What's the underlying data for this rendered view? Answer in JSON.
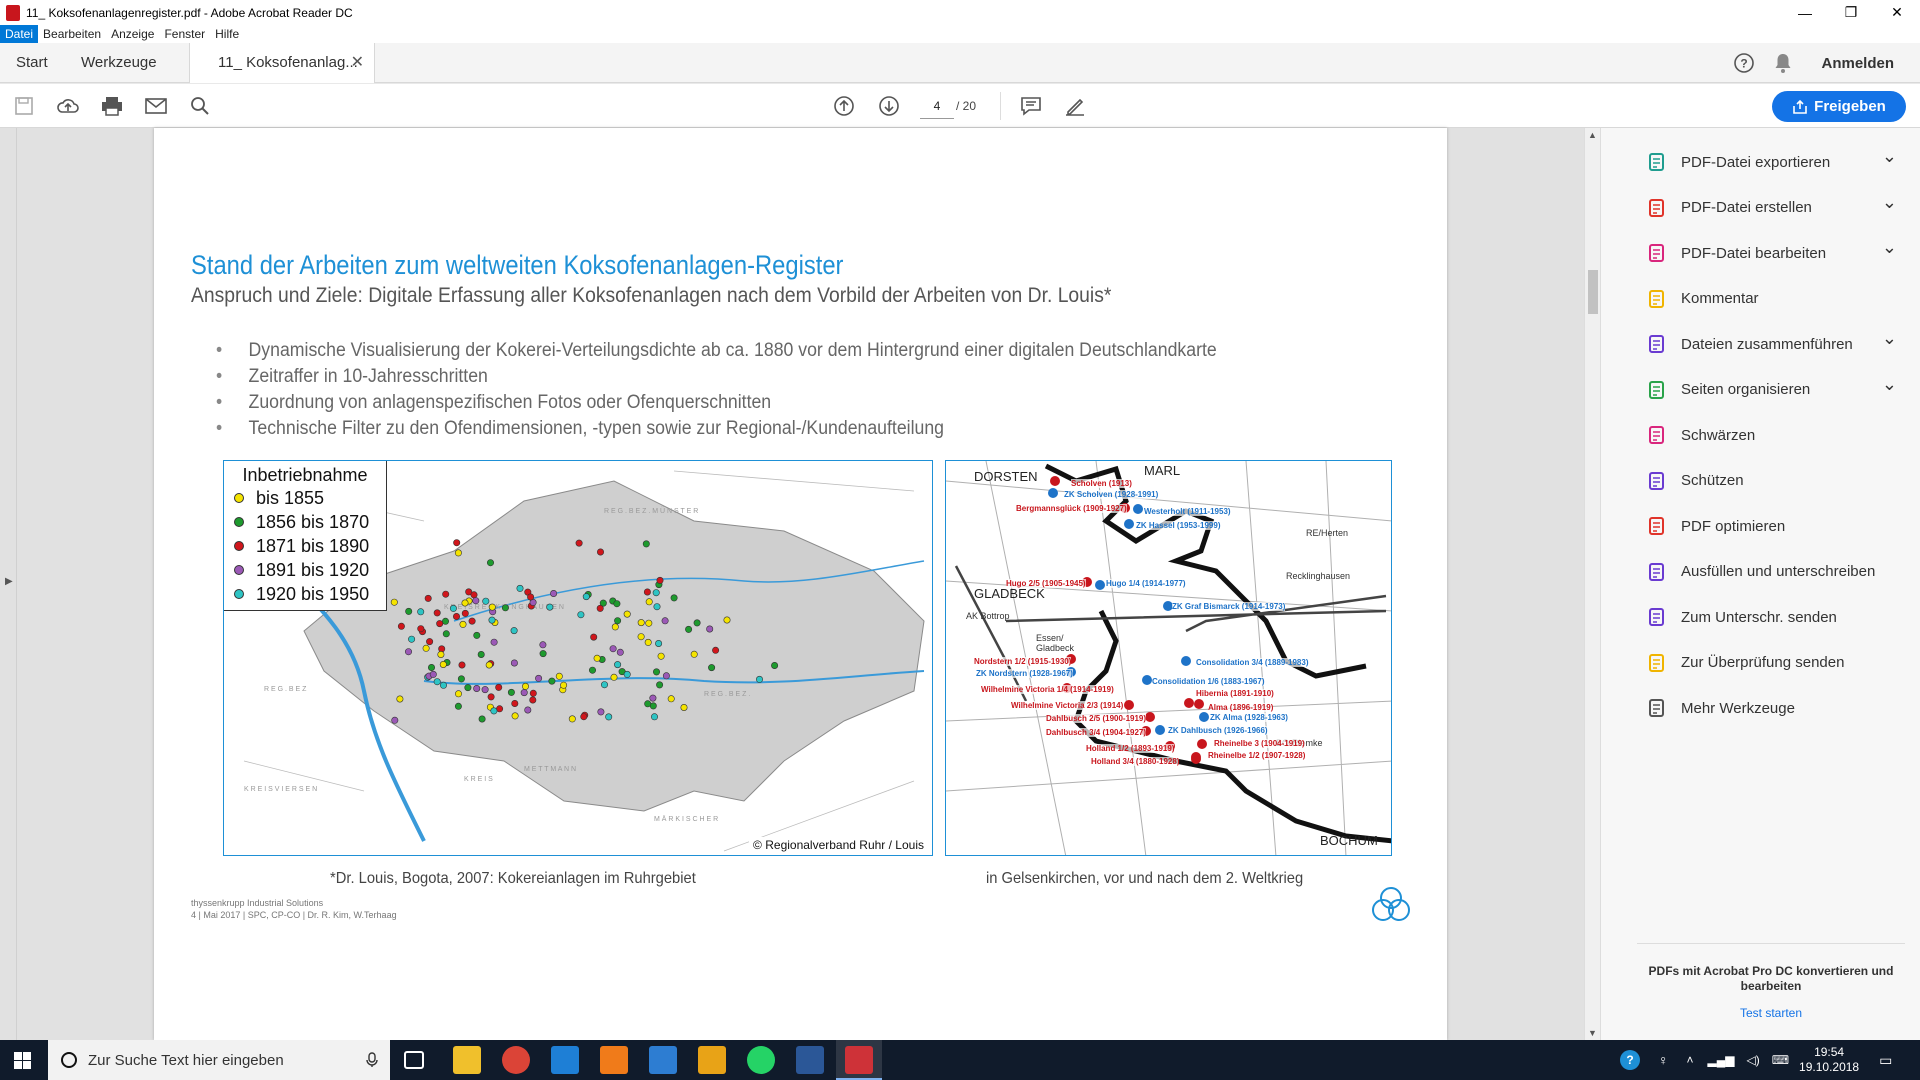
{
  "window": {
    "title": "11_ Koksofenanlagenregister.pdf - Adobe Acrobat Reader DC",
    "minimize": "—",
    "maximize": "❐",
    "close": "✕"
  },
  "menu": [
    "Datei",
    "Bearbeiten",
    "Anzeige",
    "Fenster",
    "Hilfe"
  ],
  "tabs": {
    "start": "Start",
    "tools": "Werkzeuge",
    "doc": "11_ Koksofenanlag...",
    "signin": "Anmelden"
  },
  "toolbar": {
    "page_current": "4",
    "page_total": "/ 20",
    "share_label": "Freigeben"
  },
  "slide": {
    "title": "Stand der Arbeiten zum weltweiten Koksofenanlagen-Register",
    "subtitle": "Anspruch und Ziele: Digitale Erfassung aller Koksofenanlagen nach dem Vorbild der Arbeiten von Dr. Louis*",
    "bullets": [
      "Dynamische Visualisierung der Kokerei-Verteilungsdichte ab ca. 1880 vor dem Hintergrund einer digitalen Deutschlandkarte",
      "Zeitraffer in 10-Jahresschritten",
      "Zuordnung von anlagenspezifischen Fotos oder Ofenquerschnitten",
      "Technische Filter zu den Ofendimensionen, -typen sowie zur Regional-/Kundenaufteilung"
    ],
    "legend": {
      "title": "Inbetriebnahme",
      "items": [
        {
          "label": "bis 1855",
          "color": "#f5e400"
        },
        {
          "label": "1856 bis 1870",
          "color": "#1e9a2e"
        },
        {
          "label": "1871 bis 1890",
          "color": "#d0161c"
        },
        {
          "label": "1891 bis 1920",
          "color": "#9b59b6"
        },
        {
          "label": "1920 bis 1950",
          "color": "#2ec4c4"
        }
      ]
    },
    "map1_copyright": "© Regionalverband Ruhr / Louis",
    "map2_labels": {
      "red": [
        "Scholven (1913)",
        "Bergmannsglück (1909-1927)",
        "Hugo 2/5 (1905-1945)",
        "Nordstern 1/2 (1915-1930)",
        "Wilhelmine Victoria 1/4 (1914-1919)",
        "Wilhelmine Victoria 2/3 (1914)",
        "Hibernia (1891-1910)",
        "Alma (1896-1919)",
        "Dahlbusch 2/5 (1900-1919)",
        "Dahlbusch 3/4 (1904-1927)",
        "Holland 1/2 (1893-1919)",
        "Holland 3/4 (1880-1928)",
        "Rheinelbe 3 (1904-1919)",
        "Rheinelbe 1/2 (1907-1928)"
      ],
      "blue": [
        "ZK Scholven (1928-1991)",
        "Westerholt (1911-1953)",
        "ZK Hassel (1953-1999)",
        "Hugo 1/4 (1914-1977)",
        "ZK Graf Bismarck (1914-1973)",
        "ZK Nordstern (1928-1967)",
        "Consolidation 3/4 (1889-1983)",
        "Consolidation 1/6 (1883-1967)",
        "ZK Alma (1928-1963)",
        "ZK Dahlbusch (1926-1966)"
      ],
      "places": [
        "DORSTEN",
        "MARL",
        "GLADBECK",
        "BOCHUM"
      ]
    },
    "caption_left": "*Dr. Louis, Bogota, 2007: Kokereianlagen im Ruhrgebiet",
    "caption_right": "in Gelsenkirchen, vor und nach dem 2. Weltkrieg",
    "footer_line1": "thyssenkrupp Industrial Solutions",
    "footer_line2": "4        | Mai 2017 | SPC, CP-CO | Dr. R. Kim, W.Terhaag"
  },
  "tools": [
    {
      "label": "PDF-Datei exportieren",
      "icon": "export-pdf-icon",
      "color": "#1f9d8f",
      "chevron": true
    },
    {
      "label": "PDF-Datei erstellen",
      "icon": "create-pdf-icon",
      "color": "#e0342a",
      "chevron": true
    },
    {
      "label": "PDF-Datei bearbeiten",
      "icon": "edit-pdf-icon",
      "color": "#d9267d",
      "chevron": true
    },
    {
      "label": "Kommentar",
      "icon": "comment-icon",
      "color": "#f0b400",
      "chevron": false
    },
    {
      "label": "Dateien zusammenführen",
      "icon": "combine-files-icon",
      "color": "#6a3bd1",
      "chevron": true
    },
    {
      "label": "Seiten organisieren",
      "icon": "organize-pages-icon",
      "color": "#2aa34a",
      "chevron": true
    },
    {
      "label": "Schwärzen",
      "icon": "redact-icon",
      "color": "#d9267d",
      "chevron": false
    },
    {
      "label": "Schützen",
      "icon": "protect-icon",
      "color": "#6a3bd1",
      "chevron": false
    },
    {
      "label": "PDF optimieren",
      "icon": "optimize-pdf-icon",
      "color": "#e0342a",
      "chevron": false
    },
    {
      "label": "Ausfüllen und unterschreiben",
      "icon": "fill-sign-icon",
      "color": "#6a3bd1",
      "chevron": false
    },
    {
      "label": "Zum Unterschr. senden",
      "icon": "send-signature-icon",
      "color": "#6a3bd1",
      "chevron": false
    },
    {
      "label": "Zur Überprüfung senden",
      "icon": "send-review-icon",
      "color": "#f0b400",
      "chevron": false
    },
    {
      "label": "Mehr Werkzeuge",
      "icon": "more-tools-icon",
      "color": "#555555",
      "chevron": false
    }
  ],
  "promo": {
    "text": "PDFs mit Acrobat Pro DC konvertieren und bearbeiten",
    "link": "Test starten"
  },
  "taskbar": {
    "search_placeholder": "Zur Suche Text hier eingeben",
    "time": "19:54",
    "date": "19.10.2018"
  }
}
